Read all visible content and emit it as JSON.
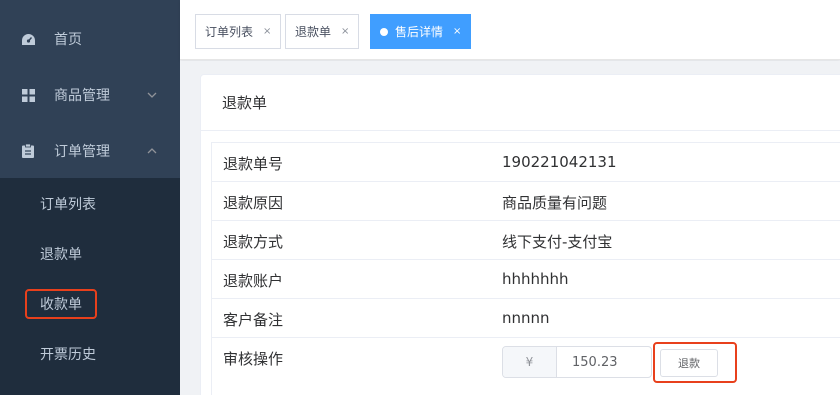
{
  "sidebar": {
    "items": [
      {
        "label": "首页",
        "icon": "dashboard-icon"
      },
      {
        "label": "商品管理",
        "icon": "grid-icon"
      },
      {
        "label": "订单管理",
        "icon": "clipboard-icon"
      }
    ],
    "submenu": [
      {
        "label": "订单列表"
      },
      {
        "label": "退款单"
      },
      {
        "label": "收款单"
      },
      {
        "label": "开票历史"
      }
    ],
    "highlight_color": "#e8401c"
  },
  "tabs": [
    {
      "label": "订单列表",
      "close": "×"
    },
    {
      "label": "退款单",
      "close": "×"
    },
    {
      "label": "售后详情",
      "close": "×"
    }
  ],
  "card": {
    "title": "退款单",
    "rows": [
      {
        "key": "退款单号",
        "value": "190221042131"
      },
      {
        "key": "退款原因",
        "value": "商品质量有问题"
      },
      {
        "key": "退款方式",
        "value": "线下支付-支付宝"
      },
      {
        "key": "退款账户",
        "value": "hhhhhhh"
      },
      {
        "key": "客户备注",
        "value": "nnnnn"
      }
    ],
    "review": {
      "key": "审核操作",
      "currency": "¥",
      "amount": "150.23",
      "button": "退款"
    }
  },
  "colors": {
    "accent": "#409eff",
    "sidebar_bg": "#304156",
    "highlight": "#e8401c"
  }
}
